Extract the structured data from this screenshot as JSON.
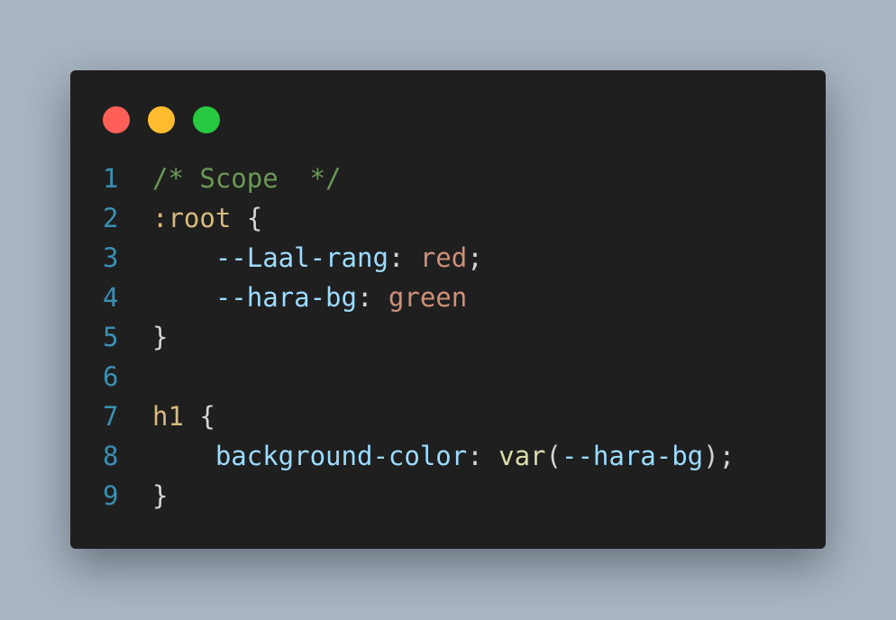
{
  "colors": {
    "background": "#a9b5c2",
    "window": "#1f1f1f",
    "close": "#ff5f57",
    "minimize": "#febc2e",
    "maximize": "#28c840",
    "line_number": "#3a8fb2",
    "comment": "#6a9955",
    "selector": "#d7ba7d",
    "punctuation": "#d4d4d4",
    "property": "#9cdcfe",
    "value": "#ce9178",
    "function": "#dcdcaa"
  },
  "window_controls": {
    "close": "close-icon",
    "minimize": "minimize-icon",
    "maximize": "maximize-icon"
  },
  "editor": {
    "lines": [
      {
        "number": "1",
        "tokens": [
          {
            "text": "/* Scope  */",
            "kind": "comment"
          }
        ]
      },
      {
        "number": "2",
        "tokens": [
          {
            "text": ":root",
            "kind": "selector"
          },
          {
            "text": " {",
            "kind": "punctuation"
          }
        ]
      },
      {
        "number": "3",
        "tokens": [
          {
            "text": "    ",
            "kind": "punctuation"
          },
          {
            "text": "--Laal-rang",
            "kind": "property"
          },
          {
            "text": ": ",
            "kind": "punctuation"
          },
          {
            "text": "red",
            "kind": "value"
          },
          {
            "text": ";",
            "kind": "punctuation"
          }
        ]
      },
      {
        "number": "4",
        "tokens": [
          {
            "text": "    ",
            "kind": "punctuation"
          },
          {
            "text": "--hara-bg",
            "kind": "property"
          },
          {
            "text": ": ",
            "kind": "punctuation"
          },
          {
            "text": "green",
            "kind": "value"
          }
        ]
      },
      {
        "number": "5",
        "tokens": [
          {
            "text": "}",
            "kind": "punctuation"
          }
        ]
      },
      {
        "number": "6",
        "tokens": []
      },
      {
        "number": "7",
        "tokens": [
          {
            "text": "h1",
            "kind": "selector"
          },
          {
            "text": " {",
            "kind": "punctuation"
          }
        ]
      },
      {
        "number": "8",
        "tokens": [
          {
            "text": "    ",
            "kind": "punctuation"
          },
          {
            "text": "background-color",
            "kind": "property"
          },
          {
            "text": ": ",
            "kind": "punctuation"
          },
          {
            "text": "var",
            "kind": "function"
          },
          {
            "text": "(",
            "kind": "punctuation"
          },
          {
            "text": "--hara-bg",
            "kind": "property"
          },
          {
            "text": ");",
            "kind": "punctuation"
          }
        ]
      },
      {
        "number": "9",
        "tokens": [
          {
            "text": "}",
            "kind": "punctuation"
          }
        ]
      }
    ]
  }
}
